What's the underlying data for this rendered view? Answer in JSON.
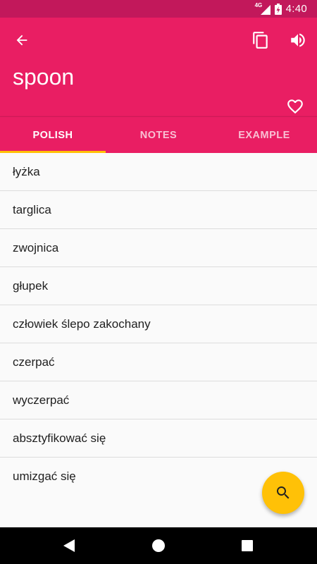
{
  "status_bar": {
    "network": "4G",
    "time": "4:40"
  },
  "app_bar": {
    "title": "spoon",
    "icons": {
      "back": "arrow-back-icon",
      "copy": "copy-icon",
      "volume": "volume-icon",
      "favorite": "heart-outline-icon"
    }
  },
  "tabs": [
    {
      "label": "POLISH",
      "active": true
    },
    {
      "label": "NOTES",
      "active": false
    },
    {
      "label": "EXAMPLE",
      "active": false
    }
  ],
  "translations": [
    "łyżka",
    "targlica",
    "zwojnica",
    "głupek",
    "człowiek ślepo zakochany",
    "czerpać",
    "wyczerpać",
    "absztyfikować się",
    "umizgać się"
  ],
  "fab": {
    "icon": "search-icon"
  },
  "colors": {
    "primary": "#e91e63",
    "primary_dark": "#c2185b",
    "accent": "#ffc107"
  }
}
